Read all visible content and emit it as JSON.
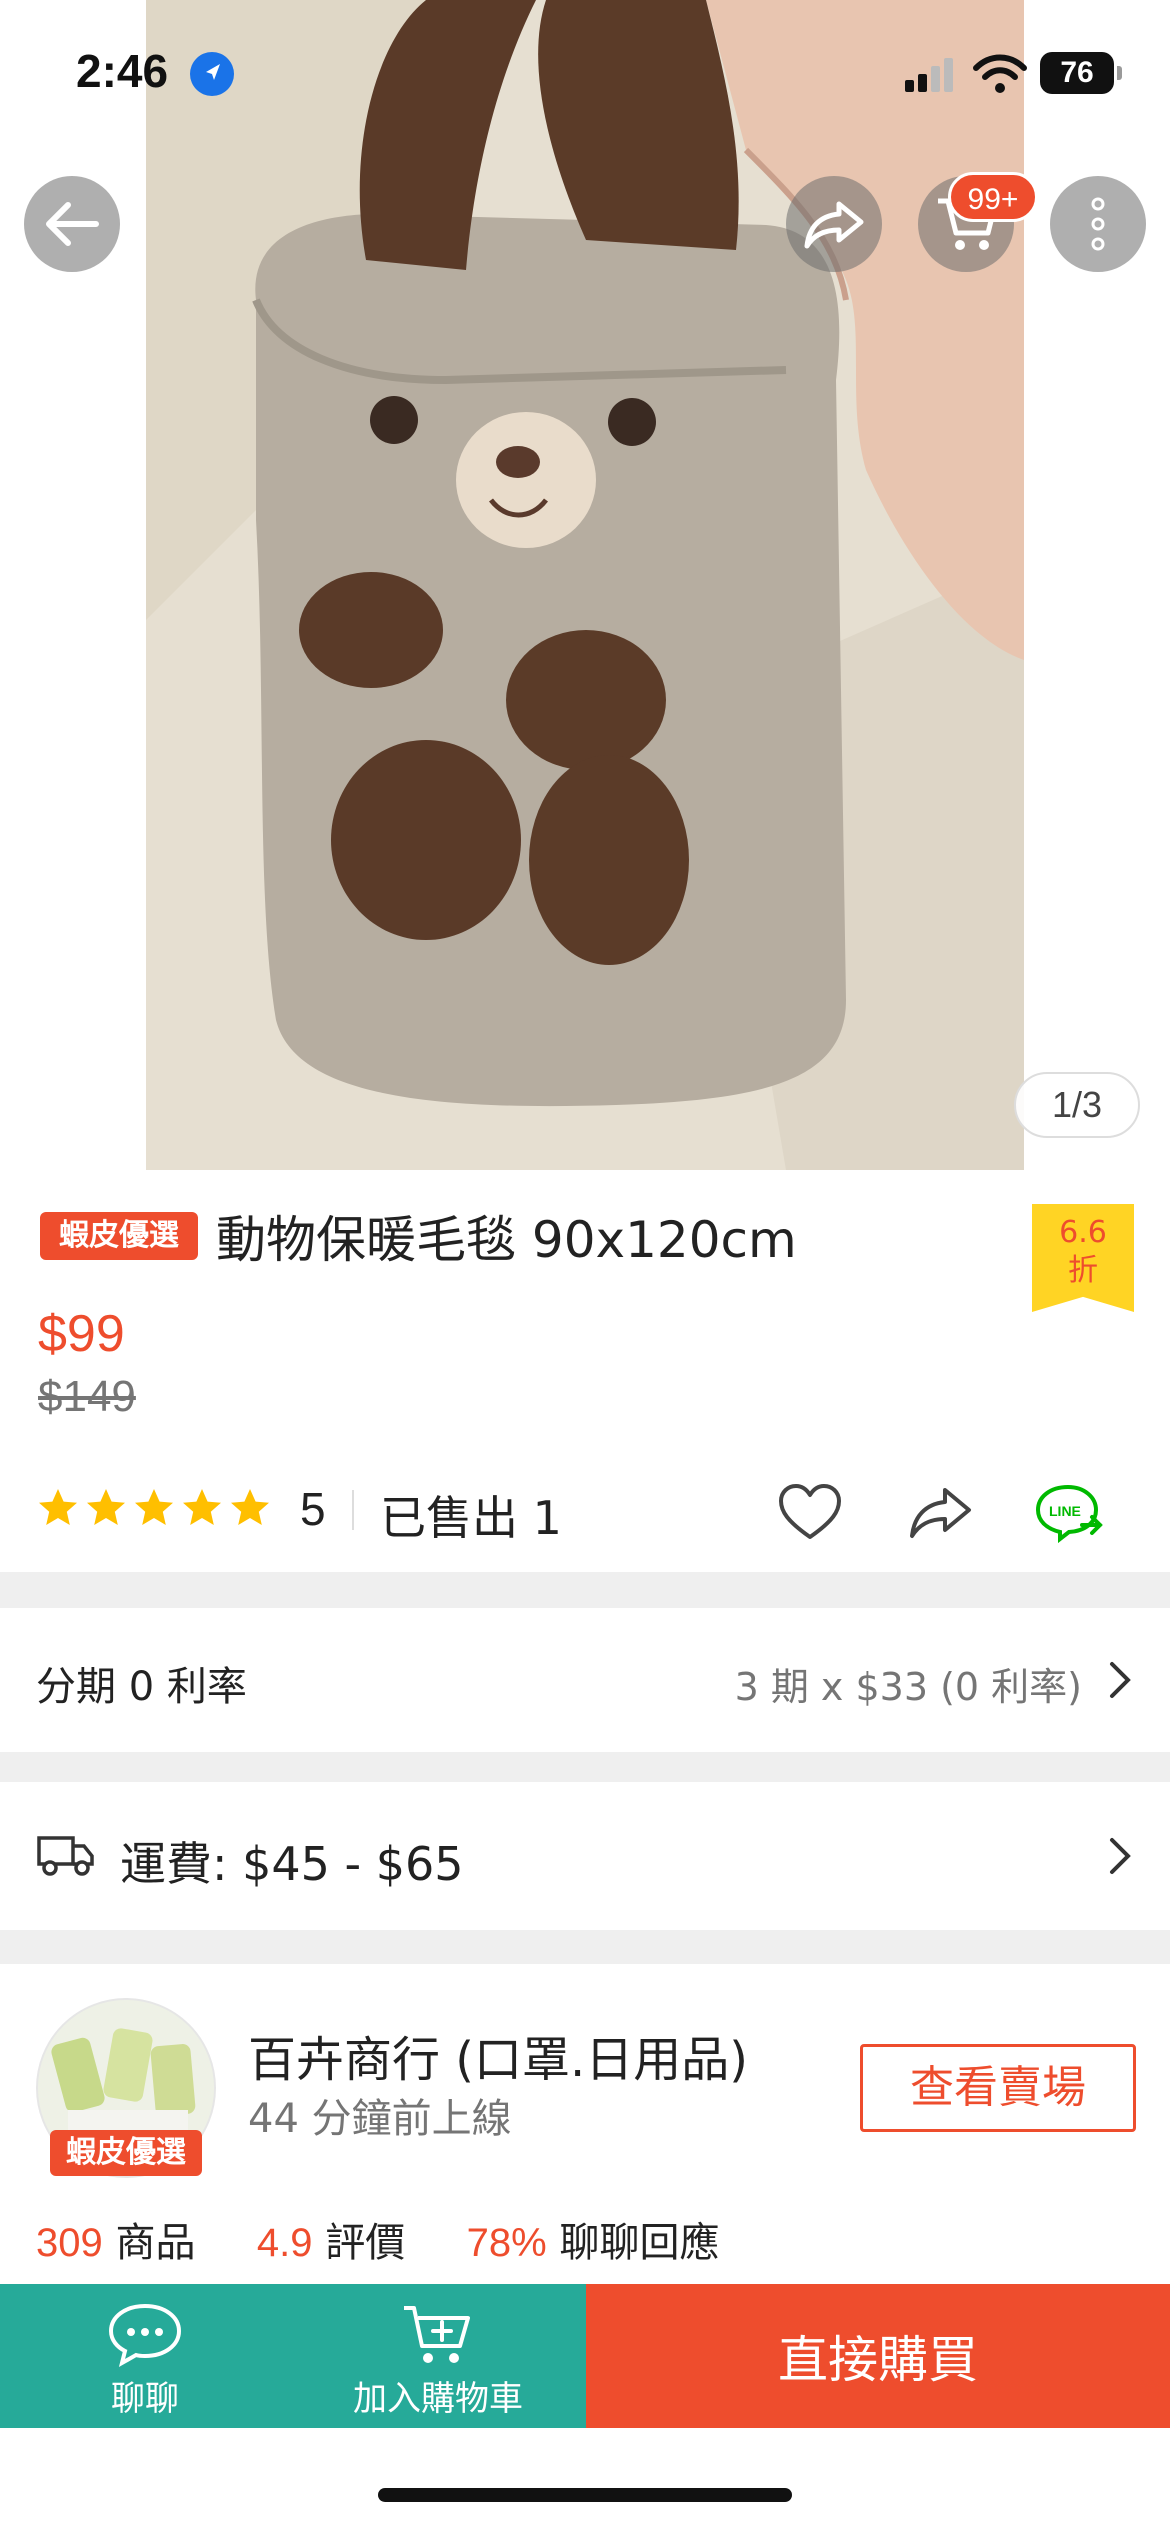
{
  "status_bar": {
    "time": "2:46",
    "battery": "76"
  },
  "top_actions": {
    "cart_badge": "99+"
  },
  "gallery": {
    "counter": "1/3"
  },
  "product": {
    "badge": "蝦皮優選",
    "title": "動物保暖毛毯 90x120cm",
    "discount_line1": "6.6",
    "discount_line2": "折",
    "price": "$99",
    "original_price": "$149",
    "rating": "5",
    "rating_stars": 5,
    "sold": "已售出 1"
  },
  "installment": {
    "label": "分期 0 利率",
    "value": "3 期 x $33 (0 利率)"
  },
  "shipping": {
    "label": "運費: $45 - $65"
  },
  "shop": {
    "badge": "蝦皮優選",
    "name": "百卉商行 (口罩.日用品)",
    "online": "44 分鐘前上線",
    "view_button": "查看賣場",
    "products_count": "309",
    "products_label": "商品",
    "rating_value": "4.9",
    "rating_label": "評價",
    "response_value": "78%",
    "response_label": "聊聊回應"
  },
  "bottom_bar": {
    "chat_label": "聊聊",
    "cart_label": "加入購物車",
    "buy_label": "直接購買"
  },
  "colors": {
    "accent": "#ee4d2d",
    "teal": "#26aa99",
    "star": "#ffbf00",
    "discount_bg": "#ffd424",
    "line_green": "#00b900"
  },
  "icons": [
    "location-arrow-icon",
    "signal-icon",
    "wifi-icon",
    "battery-icon",
    "back-arrow-icon",
    "share-icon",
    "cart-icon",
    "more-vertical-icon",
    "star-icon",
    "heart-icon",
    "line-share-icon",
    "truck-icon",
    "chevron-right-icon",
    "chat-bubble-icon",
    "add-to-cart-icon"
  ]
}
